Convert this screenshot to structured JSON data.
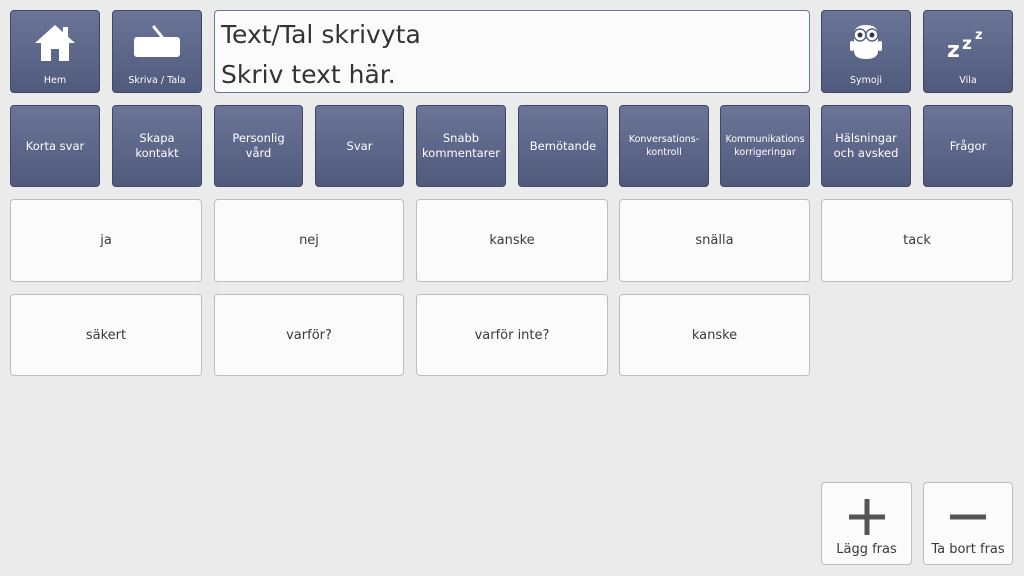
{
  "top_buttons": {
    "home": "Hem",
    "write_speak": "Skriva / Tala",
    "symoji": "Symoji",
    "rest": "Vila"
  },
  "message": {
    "line1": "Text/Tal skrivyta",
    "line2": "Skriv text här."
  },
  "categories": [
    "Korta svar",
    "Skapa\nkontakt",
    "Personlig\nvård",
    "Svar",
    "Snabb\nkommentarer",
    "Bemötande",
    "Konversations-\nkontroll",
    "Kommunikations\nkorrigeringar",
    "Hälsningar\noch avsked",
    "Frågor"
  ],
  "phrases": [
    "ja",
    "nej",
    "kanske",
    "snälla",
    "tack",
    "säkert",
    "varför?",
    "varför inte?",
    "kanske"
  ],
  "actions": {
    "add": "Lägg fras",
    "remove": "Ta bort fras"
  },
  "colors": {
    "tile_dark": "#59648a",
    "tile_light": "#fbfbfb",
    "background": "#ebebec"
  }
}
